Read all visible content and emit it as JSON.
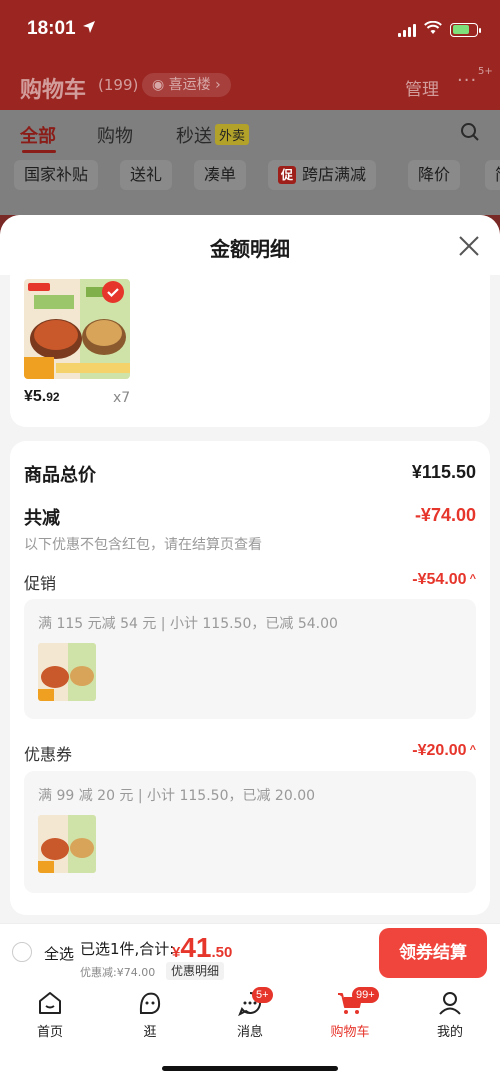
{
  "status_bar": {
    "time": "18:01"
  },
  "cart_header": {
    "title": "购物车",
    "count": "(199)",
    "address": "喜运楼",
    "manage": "管理",
    "more_badge": "5+"
  },
  "tabs": [
    {
      "label": "全部",
      "active": true
    },
    {
      "label": "购物"
    },
    {
      "label": "秒送",
      "tag": "外卖"
    }
  ],
  "filter_chips": [
    "国家补贴",
    "送礼",
    "凑单",
    "跨店满减",
    "降价",
    "简"
  ],
  "filter_chip_mark": "促",
  "sheet": {
    "title": "金额明细",
    "goods": {
      "price_main": "¥5.",
      "price_dec": "92",
      "qty": "x7"
    },
    "total_label": "商品总价",
    "total_value": "¥115.50",
    "reduce_label": "共减",
    "reduce_value": "-¥74.00",
    "note": "以下优惠不包含红包，请在结算页查看",
    "promo_label": "促销",
    "promo_value": "-¥54.00",
    "promo_detail": "满 115 元减 54 元 | 小计 115.50，已减 54.00",
    "coupon_label": "优惠券",
    "coupon_value": "-¥20.00",
    "coupon_detail": "满 99 减 20 元 | 小计 115.50，已减 20.00"
  },
  "checkout": {
    "select_all": "全选",
    "selected": "已选1件,合计:",
    "currency": "¥",
    "price_int": "41",
    "price_dec": ".50",
    "discount": "优惠减:¥74.00",
    "detail": "优惠明细",
    "button": "领券结算"
  },
  "tabbar": [
    {
      "label": "首页",
      "icon": "home-icon"
    },
    {
      "label": "逛",
      "icon": "explore-icon"
    },
    {
      "label": "消息",
      "icon": "message-icon",
      "badge": "5+"
    },
    {
      "label": "购物车",
      "icon": "cart-icon",
      "badge": "99+",
      "active": true
    },
    {
      "label": "我的",
      "icon": "profile-icon"
    }
  ],
  "colors": {
    "accent": "#e6352b",
    "button": "#f0453c",
    "header_bg": "#9b2521"
  }
}
